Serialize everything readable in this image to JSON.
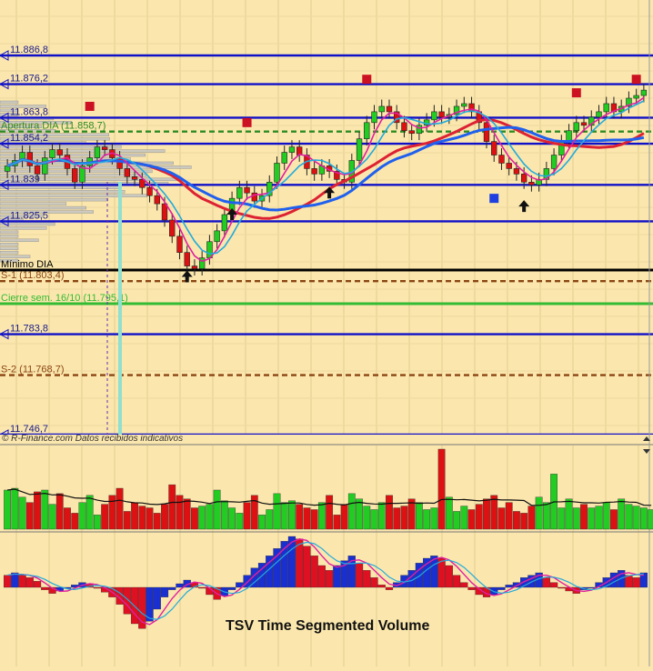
{
  "chart_data": {
    "type": "candlestick",
    "price_levels": [
      {
        "label": "11.886,8",
        "value": 11886.8,
        "color": "#1010c8",
        "style": "solid"
      },
      {
        "label": "11.876,2",
        "value": 11876.2,
        "color": "#1010c8",
        "style": "solid"
      },
      {
        "label": "11.863,8",
        "value": 11863.8,
        "color": "#1010c8",
        "style": "solid"
      },
      {
        "label": "Apertura DIA (11.858,7)",
        "value": 11858.7,
        "color": "#2e8b22",
        "style": "dashed"
      },
      {
        "label": "11.854,2",
        "value": 11854.2,
        "color": "#1010c8",
        "style": "solid"
      },
      {
        "label": "11.839",
        "value": 11839.0,
        "color": "#1010c8",
        "style": "solid"
      },
      {
        "label": "11.825,5",
        "value": 11825.5,
        "color": "#1010c8",
        "style": "solid"
      },
      {
        "label": "Mínimo DIA",
        "value": 11807.5,
        "color": "#000000",
        "style": "solid"
      },
      {
        "label": "S-1 (11.803,4)",
        "value": 11803.4,
        "color": "#8b4513",
        "style": "dashed"
      },
      {
        "label": "Cierre sem. 16/10 (11.795,1)",
        "value": 11795.1,
        "color": "#33bb33",
        "style": "solid"
      },
      {
        "label": "11.783,8",
        "value": 11783.8,
        "color": "#1010c8",
        "style": "solid"
      },
      {
        "label": "S-2 (11.768,7)",
        "value": 11768.7,
        "color": "#8b4513",
        "style": "dashed"
      },
      {
        "label": "11.746,7",
        "value": 11746.7,
        "color": "#1010c8",
        "style": "solid"
      }
    ],
    "price_series": [
      11846,
      11848,
      11851,
      11846,
      11843,
      11849,
      11852,
      11850,
      11845,
      11840,
      11846,
      11849,
      11853,
      11852,
      11849,
      11845,
      11842,
      11841,
      11838,
      11835,
      11832,
      11826,
      11820,
      11814,
      11809,
      11808,
      11812,
      11818,
      11822,
      11828,
      11834,
      11838,
      11836,
      11833,
      11835,
      11840,
      11847,
      11851,
      11853,
      11850,
      11845,
      11843,
      11846,
      11844,
      11841,
      11840,
      11848,
      11856,
      11862,
      11866,
      11868,
      11866,
      11862,
      11859,
      11858,
      11861,
      11863,
      11866,
      11864,
      11865,
      11868,
      11869,
      11866,
      11862,
      11855,
      11850,
      11847,
      11845,
      11843,
      11840,
      11839,
      11841,
      11845,
      11850,
      11855,
      11859,
      11862,
      11861,
      11864,
      11866,
      11869,
      11866,
      11868,
      11871,
      11872,
      11874
    ],
    "volume_series": [
      22,
      23,
      18,
      15,
      21,
      22,
      14,
      20,
      12,
      9,
      15,
      19,
      8,
      14,
      19,
      23,
      10,
      15,
      13,
      12,
      9,
      14,
      25,
      19,
      17,
      12,
      13,
      14,
      22,
      16,
      12,
      9,
      15,
      19,
      8,
      11,
      20,
      15,
      16,
      14,
      12,
      11,
      15,
      19,
      8,
      14,
      20,
      17,
      13,
      11,
      15,
      19,
      12,
      13,
      17,
      15,
      11,
      12,
      45,
      18,
      10,
      13,
      11,
      14,
      17,
      19,
      12,
      15,
      10,
      9,
      13,
      18,
      15,
      31,
      12,
      17,
      12,
      14,
      12,
      13,
      15,
      11,
      17,
      14,
      13,
      12,
      11
    ],
    "tsv_series": [
      10,
      12,
      10,
      8,
      5,
      -2,
      -5,
      -3,
      -1,
      2,
      4,
      3,
      0,
      -4,
      -8,
      -14,
      -22,
      -30,
      -34,
      -28,
      -18,
      -8,
      -2,
      3,
      6,
      4,
      0,
      -6,
      -10,
      -7,
      -2,
      4,
      10,
      16,
      20,
      26,
      32,
      38,
      42,
      40,
      34,
      26,
      18,
      14,
      18,
      22,
      26,
      20,
      14,
      8,
      2,
      -2,
      4,
      10,
      14,
      20,
      24,
      26,
      24,
      18,
      10,
      4,
      -2,
      -6,
      -8,
      -6,
      -2,
      2,
      4,
      8,
      10,
      12,
      8,
      4,
      0,
      -3,
      -5,
      -2,
      0,
      4,
      8,
      12,
      14,
      10,
      8,
      12
    ],
    "annotations": {
      "copyright": "© R-Finance.com Datos recibidos indicativos",
      "tsv_label": "TSV Time Segmented Volume"
    },
    "markers": {
      "red_squares": [
        {
          "x_index": 11,
          "value": 11868
        },
        {
          "x_index": 32,
          "value": 11862
        },
        {
          "x_index": 48,
          "value": 11878
        },
        {
          "x_index": 76,
          "value": 11873
        },
        {
          "x_index": 84,
          "value": 11878
        }
      ],
      "blue_squares": [
        {
          "x_index": 65,
          "value": 11834
        }
      ],
      "up_arrows": [
        {
          "x_index": 24,
          "value": 11805
        },
        {
          "x_index": 30,
          "value": 11828
        },
        {
          "x_index": 43,
          "value": 11836
        },
        {
          "x_index": 69,
          "value": 11831
        }
      ]
    }
  },
  "colors": {
    "background": "#fbe7ad",
    "candle_up": "#22cc22",
    "candle_down": "#dd1111",
    "blue_line": "#1010c8",
    "ma_slow": "#dd2233",
    "ma_fast": "#e020a0",
    "ma_blue": "#2060ee",
    "ma_cyan": "#22aadd"
  }
}
